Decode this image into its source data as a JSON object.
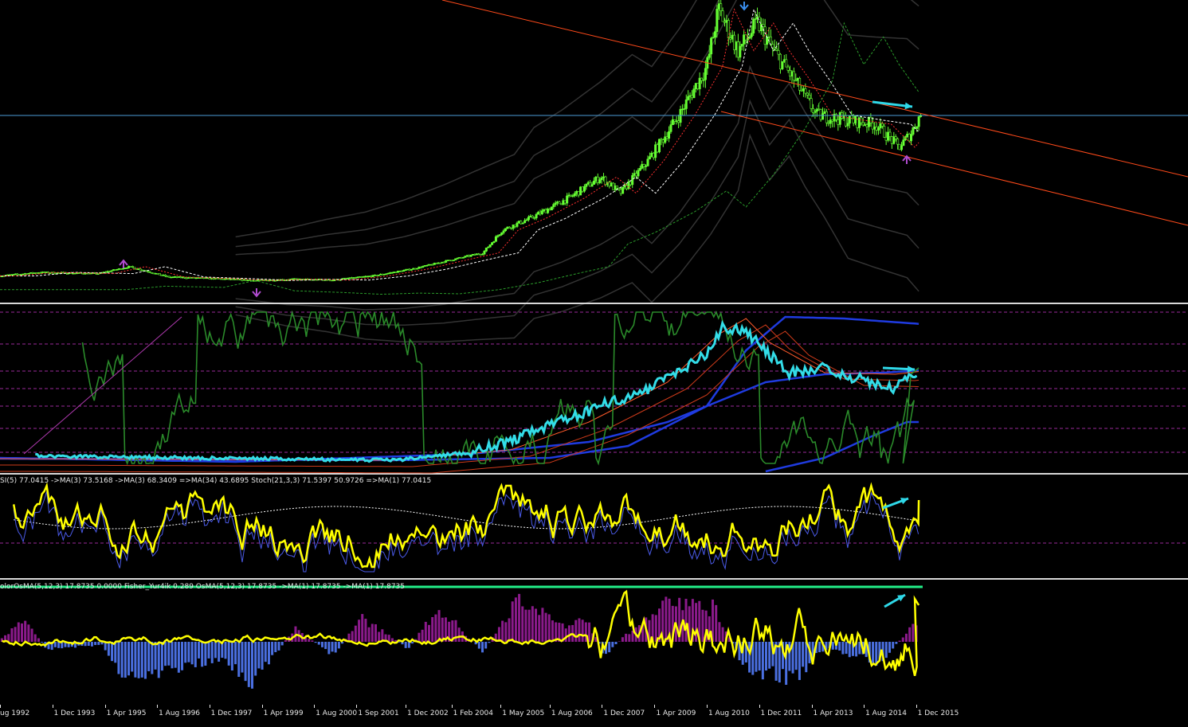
{
  "colors": {
    "background": "#000000",
    "bull_candle": "#66ff33",
    "channel": "#ff4a1a",
    "hline": "#4b9bd6",
    "arrow": "#2fd8e8",
    "up_arrow_marker": "#b04bd0",
    "down_arrow_marker": "#3a8ff0",
    "rsi_main": "#33dde8",
    "stoch": "#2a8a2a",
    "yellow": "#ffff00",
    "osma_pos": "#8b1a8b",
    "osma_neg": "#4a6fe0",
    "top_line": "#22ee88"
  },
  "panels": {
    "rsi_label": "SI(5) 77.0415  ->MA(3) 73.5168  ->MA(3) 68.3409  =>MA(34) 43.6895  Stoch(21,3,3) 71.5397 50.9726  =>MA(1) 77.0415",
    "osma_label": "olorOsMA(5,12,3) 17.8735 0.0000  Fisher_Yur4ik 0.289  OsMA(5,12,3) 17.8735  ->MA(1) 17.8735  ->MA(1) 17.8735"
  },
  "chart_data": {
    "type": "line",
    "x_axis_labels": [
      {
        "label": "ug 1992",
        "t": 0.0
      },
      {
        "label": "1 Dec 1993",
        "t": 1.33
      },
      {
        "label": "1 Apr 1995",
        "t": 2.67
      },
      {
        "label": "1 Aug 1996",
        "t": 4.0
      },
      {
        "label": "1 Dec 1997",
        "t": 5.33
      },
      {
        "label": "1 Apr 1999",
        "t": 6.67
      },
      {
        "label": "1 Aug 2000",
        "t": 8.0
      },
      {
        "label": "1 Sep 2001",
        "t": 9.08
      },
      {
        "label": "1 Dec 2002",
        "t": 10.33
      },
      {
        "label": "1 Feb 2004",
        "t": 11.5
      },
      {
        "label": "1 May 2005",
        "t": 12.75
      },
      {
        "label": "1 Aug 2006",
        "t": 14.0
      },
      {
        "label": "1 Dec 2007",
        "t": 15.33
      },
      {
        "label": "1 Apr 2009",
        "t": 16.67
      },
      {
        "label": "1 Aug 2010",
        "t": 18.0
      },
      {
        "label": "1 Dec 2011",
        "t": 19.33
      },
      {
        "label": "1 Apr 2013",
        "t": 20.67
      },
      {
        "label": "1 Aug 2014",
        "t": 22.0
      },
      {
        "label": "1 Dec 2015",
        "t": 23.33
      }
    ],
    "t_max": 23.5,
    "price_key": [
      [
        0.0,
        2.0
      ],
      [
        1.0,
        3.5
      ],
      [
        2.5,
        3.0
      ],
      [
        3.3,
        6.0
      ],
      [
        4.3,
        1.5
      ],
      [
        5.5,
        0.8
      ],
      [
        6.5,
        0.0
      ],
      [
        7.5,
        0.5
      ],
      [
        8.5,
        0.2
      ],
      [
        9.5,
        2.0
      ],
      [
        10.5,
        5.0
      ],
      [
        11.5,
        9.0
      ],
      [
        12.3,
        12.0
      ],
      [
        12.8,
        22.0
      ],
      [
        13.5,
        27.0
      ],
      [
        14.5,
        36.0
      ],
      [
        15.3,
        45.0
      ],
      [
        15.8,
        38.0
      ],
      [
        16.5,
        52.0
      ],
      [
        17.3,
        72.0
      ],
      [
        18.0,
        93.0
      ],
      [
        18.3,
        118.0
      ],
      [
        18.8,
        100.0
      ],
      [
        19.3,
        112.0
      ],
      [
        19.7,
        100.0
      ],
      [
        20.2,
        88.0
      ],
      [
        20.8,
        72.0
      ],
      [
        21.5,
        70.0
      ],
      [
        22.3,
        68.0
      ],
      [
        22.9,
        58.0
      ],
      [
        23.2,
        64.0
      ],
      [
        23.5,
        74.0
      ]
    ],
    "price_ylim": [
      -2,
      120
    ],
    "rsi_ylim": [
      0,
      100
    ],
    "osma_ylim": [
      -100,
      100
    ]
  }
}
